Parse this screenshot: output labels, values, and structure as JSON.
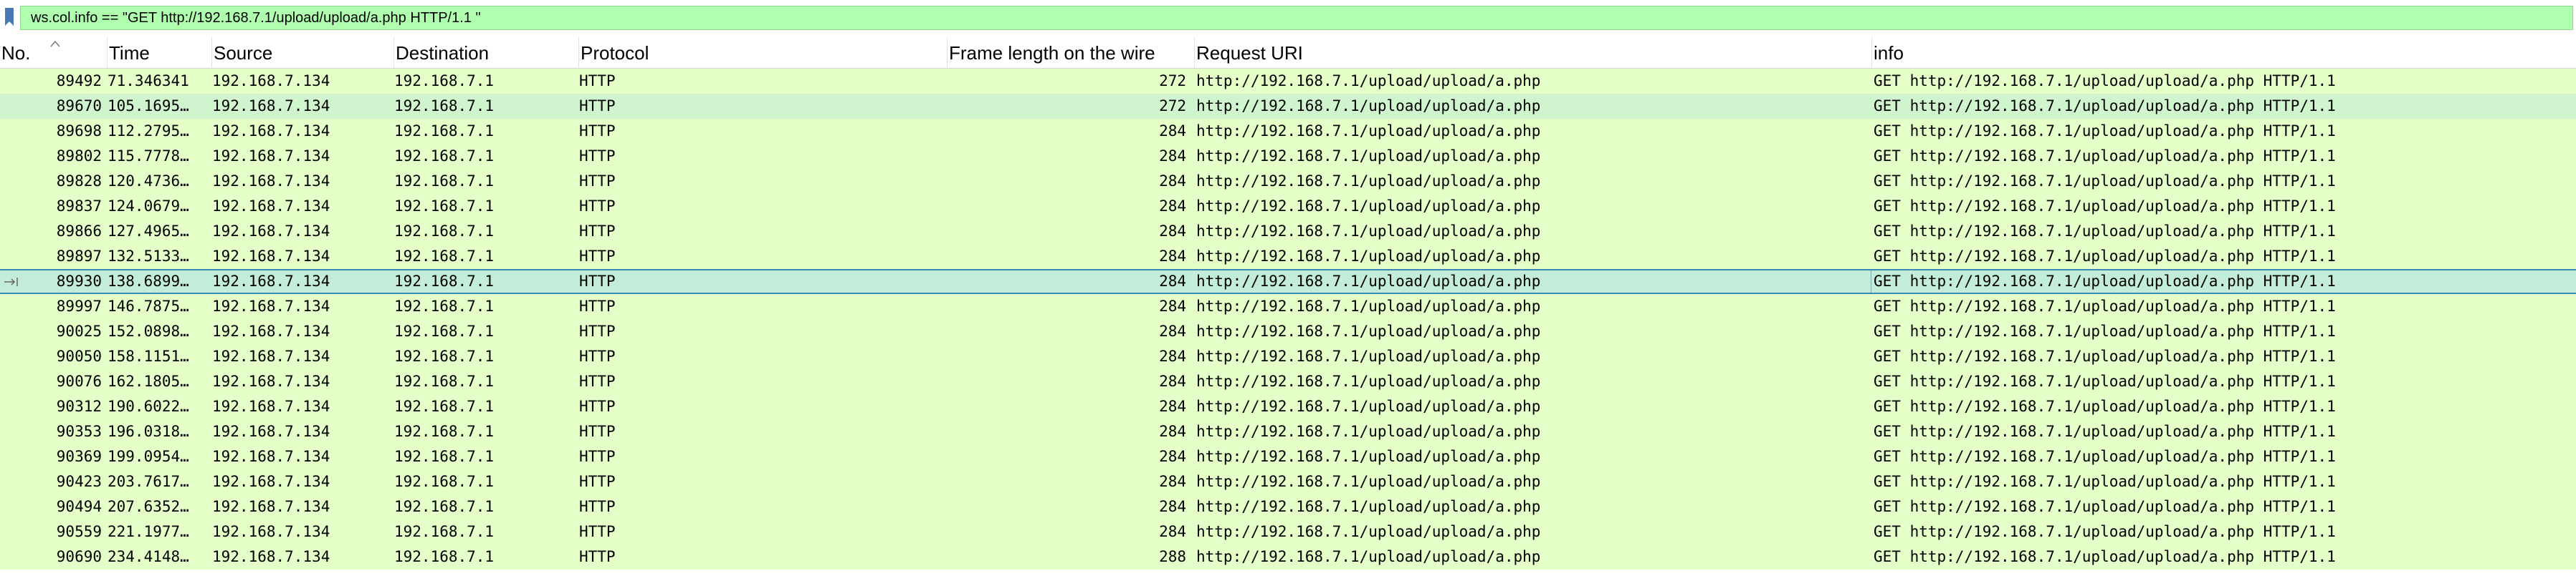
{
  "filter": {
    "text": "ws.col.info == \"GET http://192.168.7.1/upload/upload/a.php HTTP/1.1 \""
  },
  "columns": {
    "no": "No.",
    "time": "Time",
    "source": "Source",
    "destination": "Destination",
    "protocol": "Protocol",
    "frame_length": "Frame length on the wire",
    "request_uri": "Request URI",
    "info": "info"
  },
  "packets": [
    {
      "no": "89492",
      "time": "71.346341",
      "src": "192.168.7.134",
      "dst": "192.168.7.1",
      "proto": "HTTP",
      "len": "272",
      "uri": "http://192.168.7.1/upload/upload/a.php",
      "info": "GET http://192.168.7.1/upload/upload/a.php HTTP/1.1"
    },
    {
      "no": "89670",
      "time": "105.1695…",
      "src": "192.168.7.134",
      "dst": "192.168.7.1",
      "proto": "HTTP",
      "len": "272",
      "uri": "http://192.168.7.1/upload/upload/a.php",
      "info": "GET http://192.168.7.1/upload/upload/a.php HTTP/1.1"
    },
    {
      "no": "89698",
      "time": "112.2795…",
      "src": "192.168.7.134",
      "dst": "192.168.7.1",
      "proto": "HTTP",
      "len": "284",
      "uri": "http://192.168.7.1/upload/upload/a.php",
      "info": "GET http://192.168.7.1/upload/upload/a.php HTTP/1.1"
    },
    {
      "no": "89802",
      "time": "115.7778…",
      "src": "192.168.7.134",
      "dst": "192.168.7.1",
      "proto": "HTTP",
      "len": "284",
      "uri": "http://192.168.7.1/upload/upload/a.php",
      "info": "GET http://192.168.7.1/upload/upload/a.php HTTP/1.1"
    },
    {
      "no": "89828",
      "time": "120.4736…",
      "src": "192.168.7.134",
      "dst": "192.168.7.1",
      "proto": "HTTP",
      "len": "284",
      "uri": "http://192.168.7.1/upload/upload/a.php",
      "info": "GET http://192.168.7.1/upload/upload/a.php HTTP/1.1"
    },
    {
      "no": "89837",
      "time": "124.0679…",
      "src": "192.168.7.134",
      "dst": "192.168.7.1",
      "proto": "HTTP",
      "len": "284",
      "uri": "http://192.168.7.1/upload/upload/a.php",
      "info": "GET http://192.168.7.1/upload/upload/a.php HTTP/1.1"
    },
    {
      "no": "89866",
      "time": "127.4965…",
      "src": "192.168.7.134",
      "dst": "192.168.7.1",
      "proto": "HTTP",
      "len": "284",
      "uri": "http://192.168.7.1/upload/upload/a.php",
      "info": "GET http://192.168.7.1/upload/upload/a.php HTTP/1.1"
    },
    {
      "no": "89897",
      "time": "132.5133…",
      "src": "192.168.7.134",
      "dst": "192.168.7.1",
      "proto": "HTTP",
      "len": "284",
      "uri": "http://192.168.7.1/upload/upload/a.php",
      "info": "GET http://192.168.7.1/upload/upload/a.php HTTP/1.1"
    },
    {
      "no": "89930",
      "time": "138.6899…",
      "src": "192.168.7.134",
      "dst": "192.168.7.1",
      "proto": "HTTP",
      "len": "284",
      "uri": "http://192.168.7.1/upload/upload/a.php",
      "info": "GET http://192.168.7.1/upload/upload/a.php HTTP/1.1"
    },
    {
      "no": "89997",
      "time": "146.7875…",
      "src": "192.168.7.134",
      "dst": "192.168.7.1",
      "proto": "HTTP",
      "len": "284",
      "uri": "http://192.168.7.1/upload/upload/a.php",
      "info": "GET http://192.168.7.1/upload/upload/a.php HTTP/1.1"
    },
    {
      "no": "90025",
      "time": "152.0898…",
      "src": "192.168.7.134",
      "dst": "192.168.7.1",
      "proto": "HTTP",
      "len": "284",
      "uri": "http://192.168.7.1/upload/upload/a.php",
      "info": "GET http://192.168.7.1/upload/upload/a.php HTTP/1.1"
    },
    {
      "no": "90050",
      "time": "158.1151…",
      "src": "192.168.7.134",
      "dst": "192.168.7.1",
      "proto": "HTTP",
      "len": "284",
      "uri": "http://192.168.7.1/upload/upload/a.php",
      "info": "GET http://192.168.7.1/upload/upload/a.php HTTP/1.1"
    },
    {
      "no": "90076",
      "time": "162.1805…",
      "src": "192.168.7.134",
      "dst": "192.168.7.1",
      "proto": "HTTP",
      "len": "284",
      "uri": "http://192.168.7.1/upload/upload/a.php",
      "info": "GET http://192.168.7.1/upload/upload/a.php HTTP/1.1"
    },
    {
      "no": "90312",
      "time": "190.6022…",
      "src": "192.168.7.134",
      "dst": "192.168.7.1",
      "proto": "HTTP",
      "len": "284",
      "uri": "http://192.168.7.1/upload/upload/a.php",
      "info": "GET http://192.168.7.1/upload/upload/a.php HTTP/1.1"
    },
    {
      "no": "90353",
      "time": "196.0318…",
      "src": "192.168.7.134",
      "dst": "192.168.7.1",
      "proto": "HTTP",
      "len": "284",
      "uri": "http://192.168.7.1/upload/upload/a.php",
      "info": "GET http://192.168.7.1/upload/upload/a.php HTTP/1.1"
    },
    {
      "no": "90369",
      "time": "199.0954…",
      "src": "192.168.7.134",
      "dst": "192.168.7.1",
      "proto": "HTTP",
      "len": "284",
      "uri": "http://192.168.7.1/upload/upload/a.php",
      "info": "GET http://192.168.7.1/upload/upload/a.php HTTP/1.1"
    },
    {
      "no": "90423",
      "time": "203.7617…",
      "src": "192.168.7.134",
      "dst": "192.168.7.1",
      "proto": "HTTP",
      "len": "284",
      "uri": "http://192.168.7.1/upload/upload/a.php",
      "info": "GET http://192.168.7.1/upload/upload/a.php HTTP/1.1"
    },
    {
      "no": "90494",
      "time": "207.6352…",
      "src": "192.168.7.134",
      "dst": "192.168.7.1",
      "proto": "HTTP",
      "len": "284",
      "uri": "http://192.168.7.1/upload/upload/a.php",
      "info": "GET http://192.168.7.1/upload/upload/a.php HTTP/1.1"
    },
    {
      "no": "90559",
      "time": "221.1977…",
      "src": "192.168.7.134",
      "dst": "192.168.7.1",
      "proto": "HTTP",
      "len": "284",
      "uri": "http://192.168.7.1/upload/upload/a.php",
      "info": "GET http://192.168.7.1/upload/upload/a.php HTTP/1.1"
    },
    {
      "no": "90690",
      "time": "234.4148…",
      "src": "192.168.7.134",
      "dst": "192.168.7.1",
      "proto": "HTTP",
      "len": "288",
      "uri": "http://192.168.7.1/upload/upload/a.php",
      "info": "GET http://192.168.7.1/upload/upload/a.php HTTP/1.1"
    }
  ],
  "selected_packet": "89930",
  "alternate_packet": "89670",
  "colors": {
    "row_bg": "#e4ffc7",
    "row_alt_bg": "#d0f5ce",
    "selected_bg": "#c3ecd9",
    "selected_border": "#3a88b8",
    "filter_bg": "#afffaf",
    "bookmark": "#4a78b5"
  },
  "icons": {
    "bookmark": "bookmark-icon",
    "sort": "sort-ascending-icon",
    "selected": "selected-row-arrow-icon"
  }
}
